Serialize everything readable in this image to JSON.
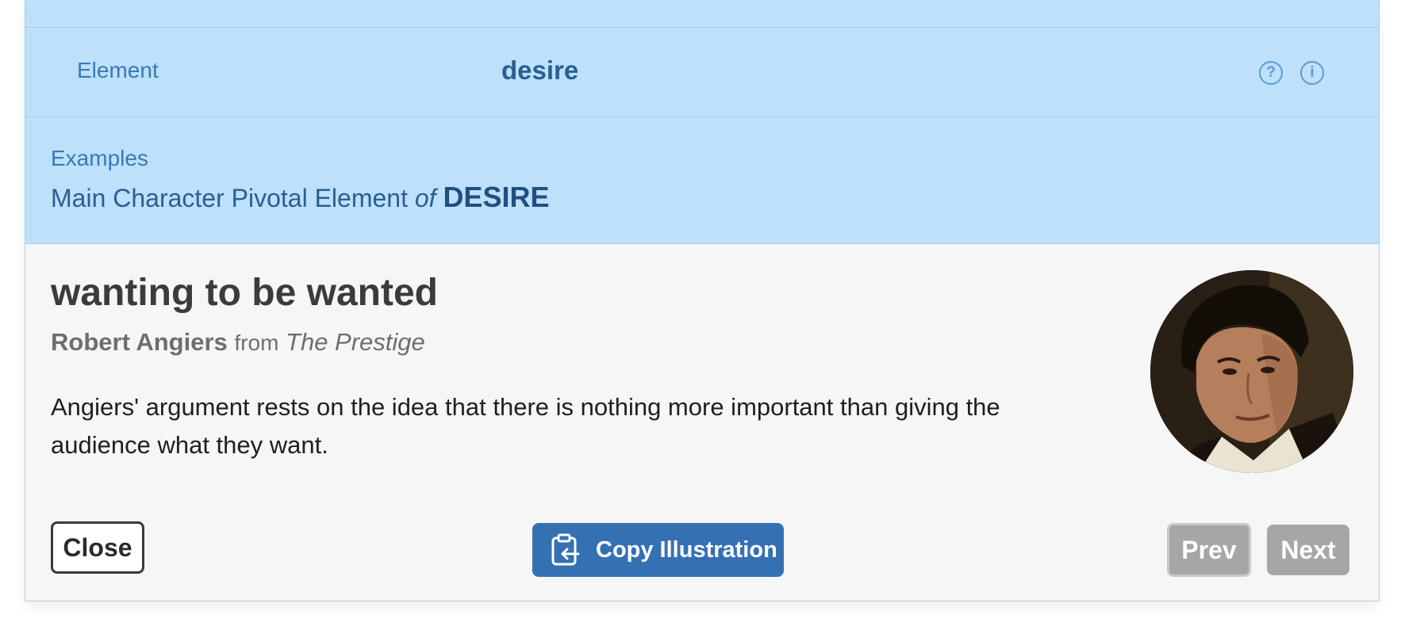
{
  "element_row": {
    "label": "Element",
    "value": "desire",
    "help_icon": "question-circle-icon",
    "info_icon": "info-circle-icon"
  },
  "examples": {
    "label": "Examples",
    "path_prefix": "Main Character Pivotal Element",
    "path_connector": "of",
    "path_target": "DESIRE"
  },
  "example": {
    "title": "wanting to be wanted",
    "character": "Robert Angiers",
    "from_word": "from",
    "work": "The Prestige",
    "description": "Angiers' argument rests on the idea that there is nothing more important than giving the audience what they want.",
    "avatar_icon": "character-portrait"
  },
  "buttons": {
    "close_label": "Close",
    "copy_label": "Copy Illustration",
    "copy_icon": "clipboard-arrow-icon",
    "prev_label": "Prev",
    "next_label": "Next"
  },
  "colors": {
    "header_bg": "#bde0fb",
    "accent_blue": "#3570b3",
    "disabled_gray": "#a6a6a6"
  }
}
